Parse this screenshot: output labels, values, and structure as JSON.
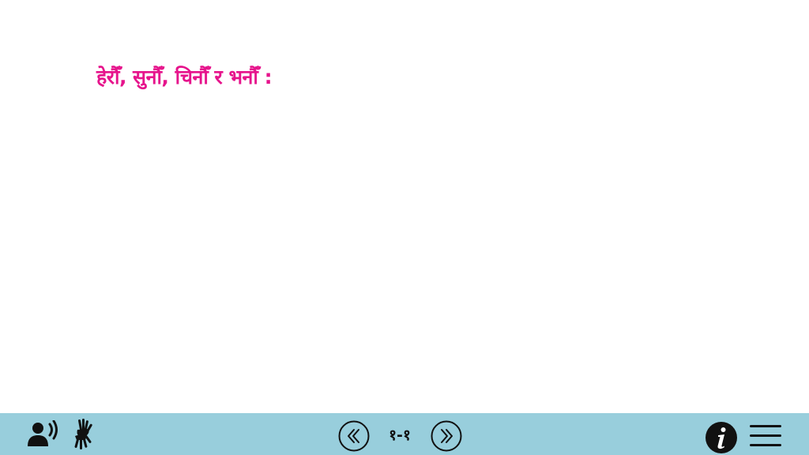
{
  "content": {
    "heading": "हेरौँ, सुनौँ, चिनौँ र भनौँ :"
  },
  "bottom_bar": {
    "background": "#98cedc",
    "page_indicator": "१-१",
    "icons": {
      "audio": "audio-speaker-icon",
      "sign_language": "sign-language-icon",
      "prev": "double-chevron-left-icon",
      "next": "double-chevron-right-icon",
      "info": "info-icon",
      "menu": "hamburger-menu-icon"
    }
  },
  "colors": {
    "accent": "#e6148c",
    "bar": "#98cedc"
  }
}
